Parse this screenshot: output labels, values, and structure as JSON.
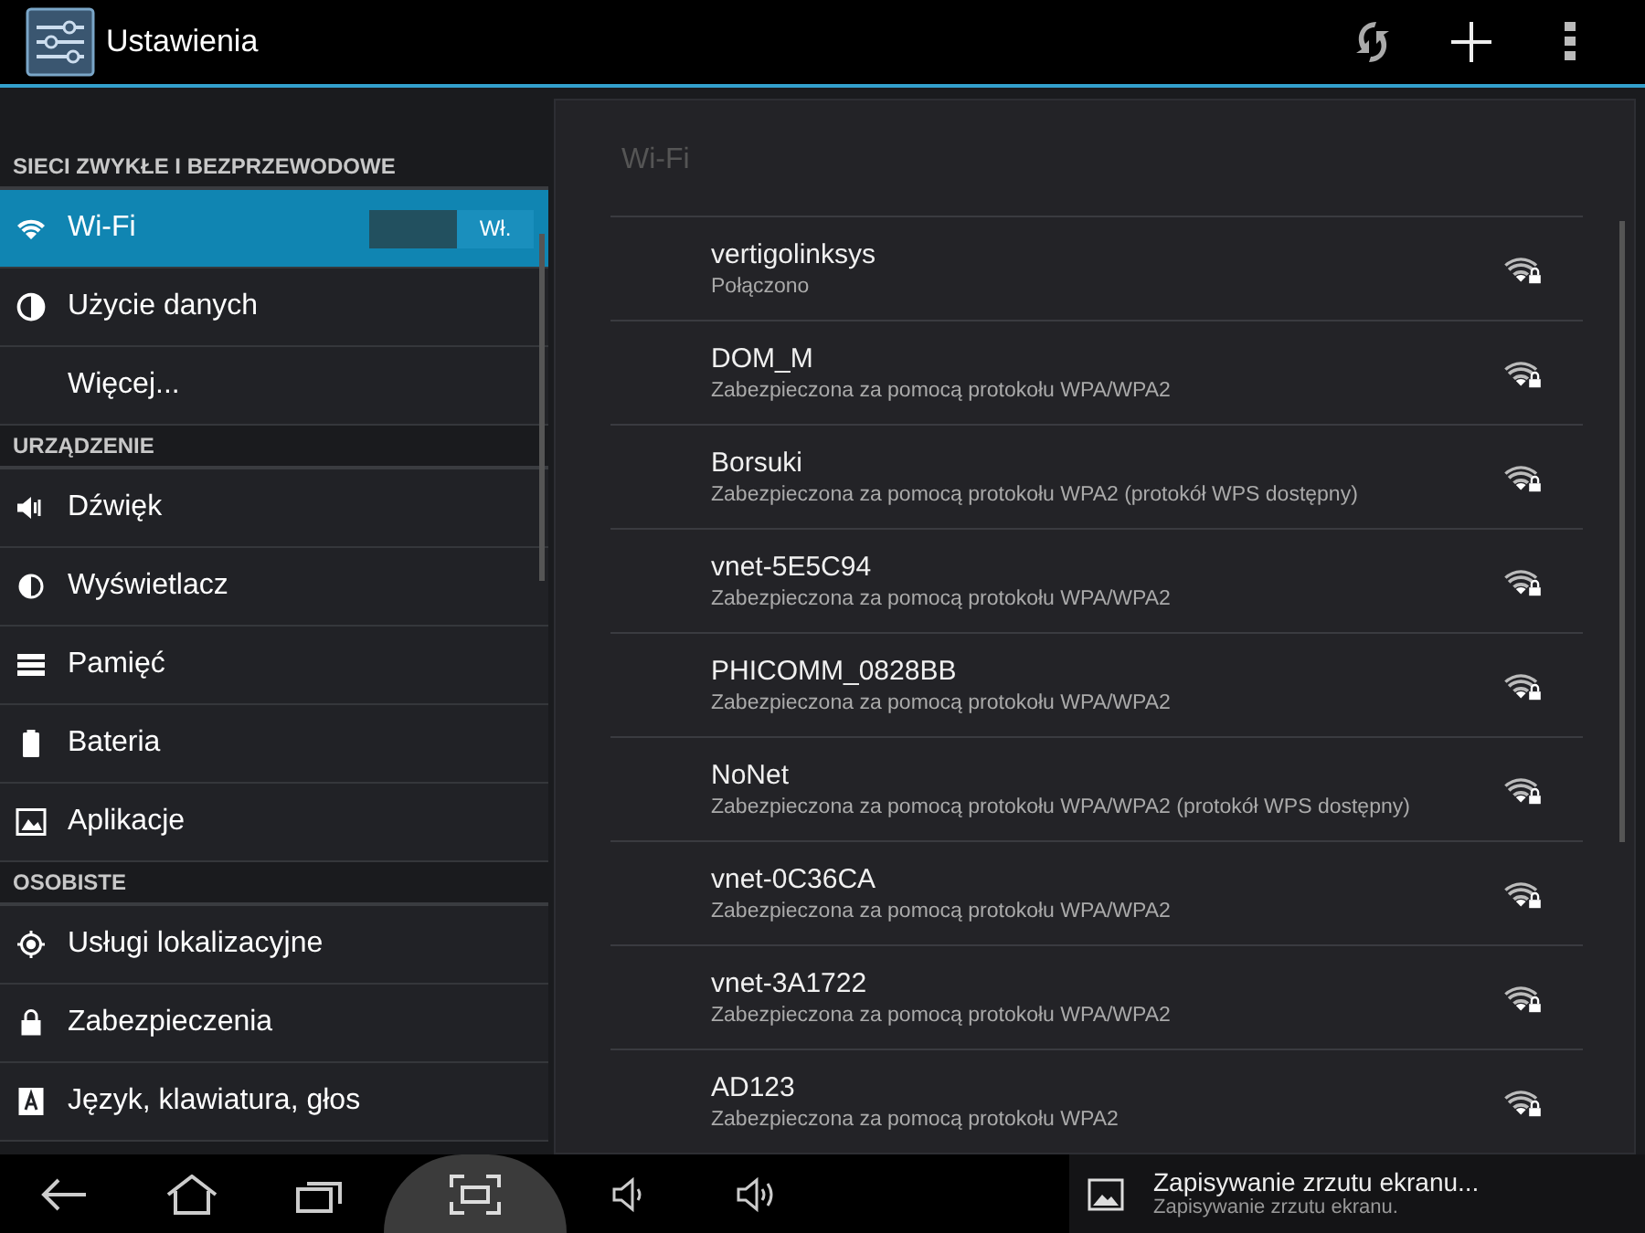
{
  "action_bar": {
    "title": "Ustawienia"
  },
  "sidebar": {
    "sections": [
      {
        "header": "SIECI ZWYKŁE I BEZPRZEWODOWE",
        "items": [
          {
            "label": "Wi-Fi",
            "selected": true,
            "toggle": {
              "label": "Wł.",
              "on": true
            }
          },
          {
            "label": "Użycie danych",
            "selected": false
          },
          {
            "label": "Więcej...",
            "selected": false
          }
        ]
      },
      {
        "header": "URZĄDZENIE",
        "items": [
          {
            "label": "Dźwięk",
            "selected": false
          },
          {
            "label": "Wyświetlacz",
            "selected": false
          },
          {
            "label": "Pamięć",
            "selected": false
          },
          {
            "label": "Bateria",
            "selected": false
          },
          {
            "label": "Aplikacje",
            "selected": false
          }
        ]
      },
      {
        "header": "OSOBISTE",
        "items": [
          {
            "label": "Usługi lokalizacyjne",
            "selected": false
          },
          {
            "label": "Zabezpieczenia",
            "selected": false
          },
          {
            "label": "Język, klawiatura, głos",
            "selected": false
          }
        ]
      }
    ]
  },
  "detail": {
    "title": "Wi-Fi",
    "networks": [
      {
        "name": "vertigolinksys",
        "status": "Połączono"
      },
      {
        "name": "DOM_M",
        "status": "Zabezpieczona za pomocą protokołu WPA/WPA2"
      },
      {
        "name": "Borsuki",
        "status": "Zabezpieczona za pomocą protokołu WPA2 (protokół WPS dostępny)"
      },
      {
        "name": "vnet-5E5C94",
        "status": "Zabezpieczona za pomocą protokołu WPA/WPA2"
      },
      {
        "name": "PHICOMM_0828BB",
        "status": "Zabezpieczona za pomocą protokołu WPA/WPA2"
      },
      {
        "name": "NoNet",
        "status": "Zabezpieczona za pomocą protokołu WPA/WPA2 (protokół WPS dostępny)"
      },
      {
        "name": "vnet-0C36CA",
        "status": "Zabezpieczona za pomocą protokołu WPA/WPA2"
      },
      {
        "name": "vnet-3A1722",
        "status": "Zabezpieczona za pomocą protokołu WPA/WPA2"
      },
      {
        "name": "AD123",
        "status": "Zabezpieczona za pomocą protokołu WPA2"
      }
    ]
  },
  "notification": {
    "title": "Zapisywanie zrzutu ekranu...",
    "text": "Zapisywanie zrzutu ekranu."
  }
}
